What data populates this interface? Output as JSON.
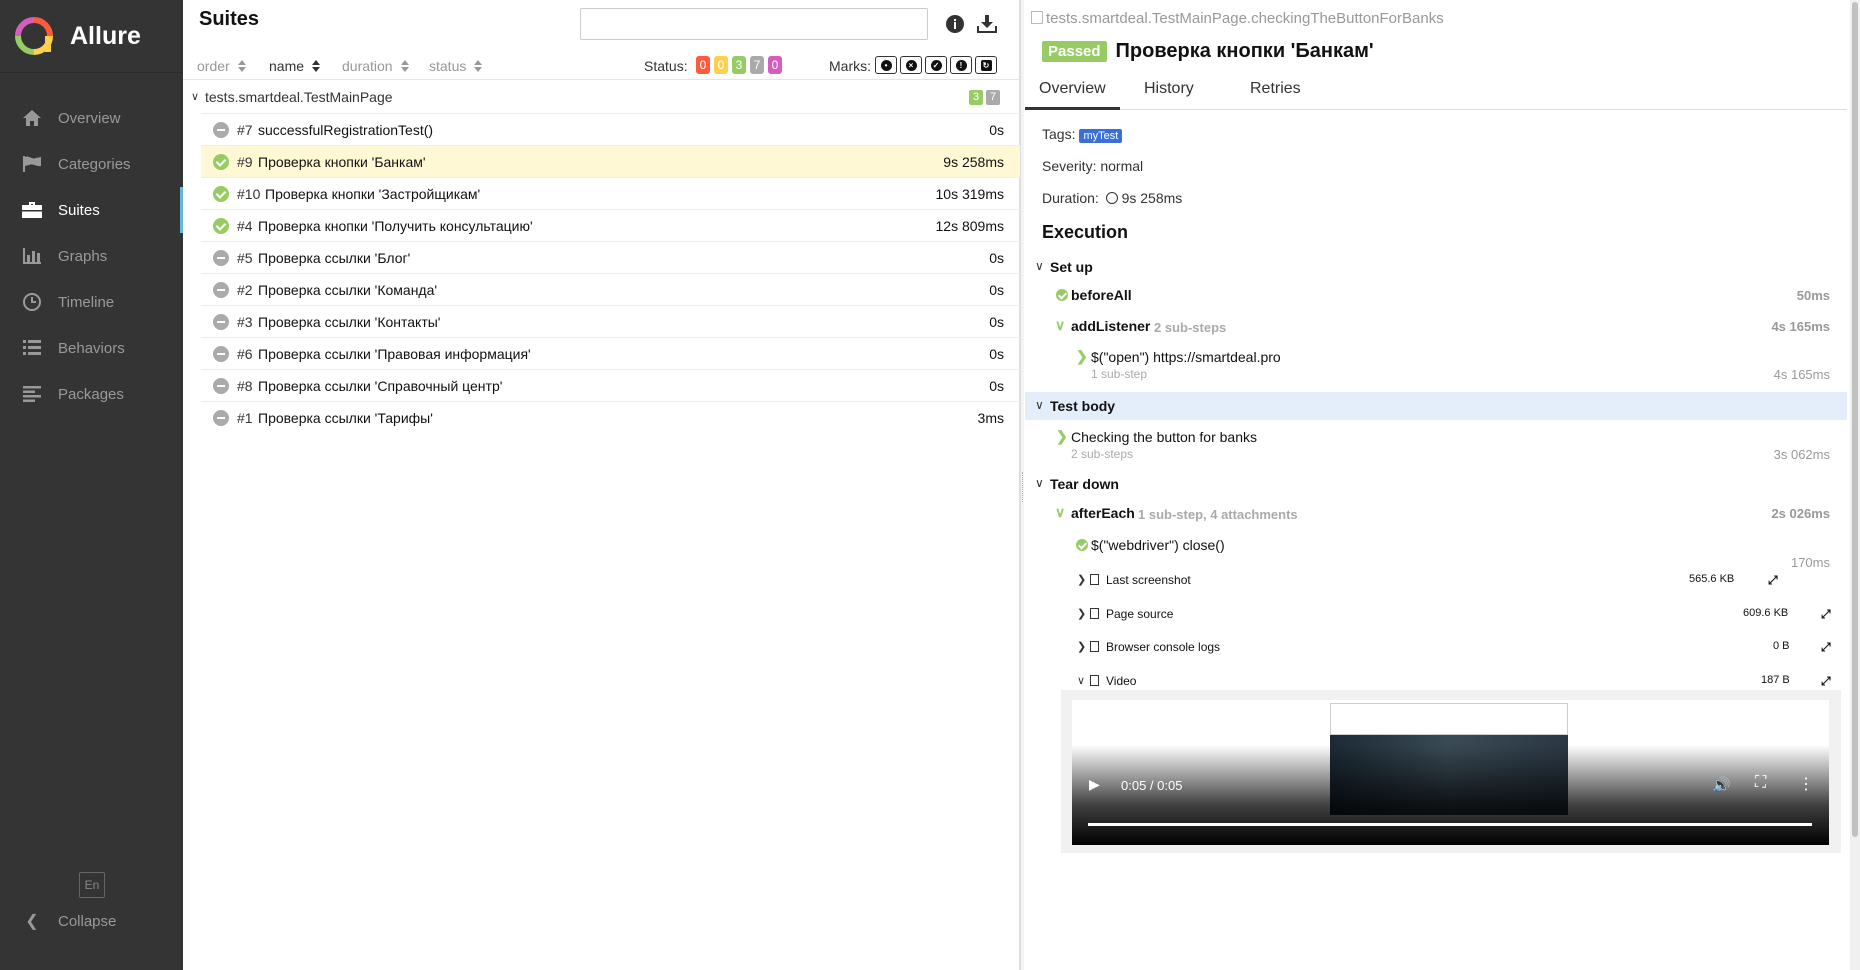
{
  "app": {
    "name": "Allure"
  },
  "sidebar": {
    "items": [
      {
        "label": "Overview",
        "icon": "home-icon"
      },
      {
        "label": "Categories",
        "icon": "flag-icon"
      },
      {
        "label": "Suites",
        "icon": "briefcase-icon",
        "active": true
      },
      {
        "label": "Graphs",
        "icon": "bar-chart-icon"
      },
      {
        "label": "Timeline",
        "icon": "clock-icon"
      },
      {
        "label": "Behaviors",
        "icon": "list-icon"
      },
      {
        "label": "Packages",
        "icon": "align-left-icon"
      }
    ],
    "lang": "En",
    "collapse": "Collapse"
  },
  "suites": {
    "title": "Suites",
    "search": {
      "value": "",
      "placeholder": ""
    },
    "sort": {
      "order": "order",
      "name": "name",
      "duration": "duration",
      "status": "status"
    },
    "status_label": "Status:",
    "status_counts": [
      {
        "value": "0",
        "color": "#fd5a3e"
      },
      {
        "value": "0",
        "color": "#ffd050"
      },
      {
        "value": "3",
        "color": "#97cc64"
      },
      {
        "value": "7",
        "color": "#aaaaaa"
      },
      {
        "value": "0",
        "color": "#d35ebe"
      }
    ],
    "marks_label": "Marks:",
    "group": {
      "name": "tests.smartdeal.TestMainPage",
      "passed": "3",
      "skipped": "7"
    },
    "rows": [
      {
        "num": "#7",
        "name": "successfulRegistrationTest()",
        "duration": "0s",
        "status": "skipped"
      },
      {
        "num": "#9",
        "name": "Проверка кнопки 'Банкам'",
        "duration": "9s 258ms",
        "status": "passed"
      },
      {
        "num": "#10",
        "name": "Проверка кнопки 'Застройщикам'",
        "duration": "10s 319ms",
        "status": "passed"
      },
      {
        "num": "#4",
        "name": "Проверка кнопки 'Получить консультацию'",
        "duration": "12s 809ms",
        "status": "passed"
      },
      {
        "num": "#5",
        "name": "Проверка ссылки 'Блог'",
        "duration": "0s",
        "status": "skipped"
      },
      {
        "num": "#2",
        "name": "Проверка ссылки 'Команда'",
        "duration": "0s",
        "status": "skipped"
      },
      {
        "num": "#3",
        "name": "Проверка ссылки 'Контакты'",
        "duration": "0s",
        "status": "skipped"
      },
      {
        "num": "#6",
        "name": "Проверка ссылки 'Правовая информация'",
        "duration": "0s",
        "status": "skipped"
      },
      {
        "num": "#8",
        "name": "Проверка ссылки 'Справочный центр'",
        "duration": "0s",
        "status": "skipped"
      },
      {
        "num": "#1",
        "name": "Проверка ссылки 'Тарифы'",
        "duration": "3ms",
        "status": "skipped"
      }
    ]
  },
  "detail": {
    "path": "tests.smartdeal.TestMainPage.checkingTheButtonForBanks",
    "status": "Passed",
    "title": "Проверка кнопки 'Банкам'",
    "tabs": [
      "Overview",
      "History",
      "Retries"
    ],
    "tags_label": "Tags:",
    "tag": "myTest",
    "severity": "Severity: normal",
    "duration_label": "Duration:",
    "duration": "9s 258ms",
    "execution": "Execution",
    "setup": {
      "title": "Set up",
      "before_all": {
        "name": "beforeAll",
        "duration": "50ms"
      },
      "add_listener": {
        "name": "addListener",
        "meta": "2 sub-steps",
        "duration": "4s 165ms"
      },
      "open": {
        "name": "$(\"open\") https://smartdeal.pro",
        "sub": "1 sub-step",
        "duration": "4s 165ms"
      }
    },
    "body": {
      "title": "Test body",
      "step": {
        "name": "Checking the button for banks",
        "sub": "2 sub-steps",
        "duration": "3s 062ms"
      }
    },
    "teardown": {
      "title": "Tear down",
      "after_each": {
        "name": "afterEach",
        "meta": "1 sub-step, 4 attachments",
        "duration": "2s 026ms"
      },
      "close": {
        "name": "$(\"webdriver\") close()",
        "duration": "170ms"
      },
      "attachments": [
        {
          "name": "Last screenshot",
          "size": "565.6 KB"
        },
        {
          "name": "Page source",
          "size": "609.6 KB"
        },
        {
          "name": "Browser console logs",
          "size": "0 B"
        },
        {
          "name": "Video",
          "size": "187 B"
        }
      ]
    },
    "video": {
      "time": "0:05 / 0:05"
    }
  }
}
